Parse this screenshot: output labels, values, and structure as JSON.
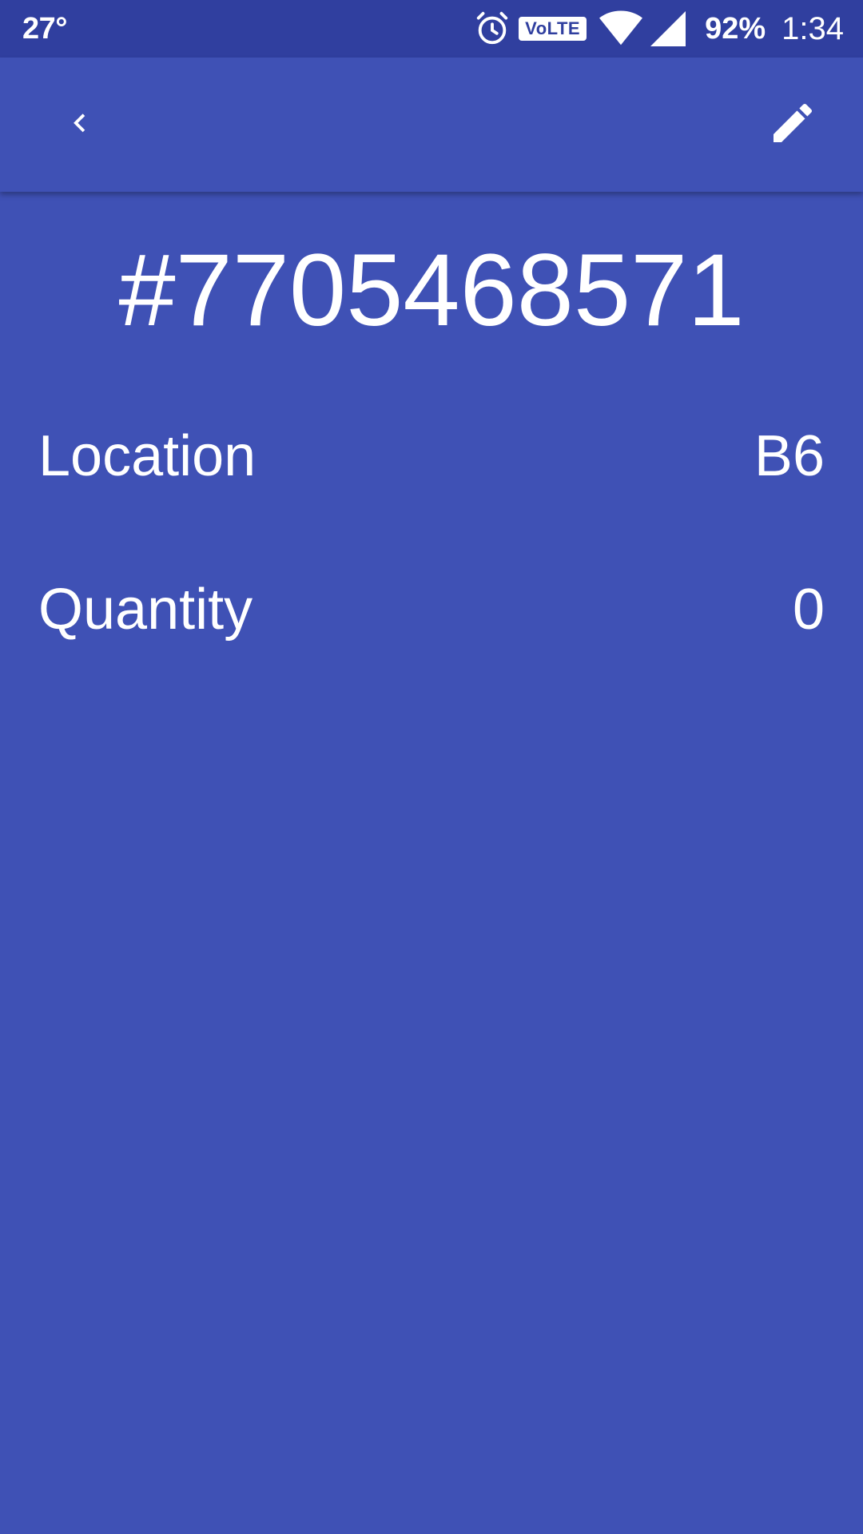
{
  "status_bar": {
    "temperature": "27°",
    "volte_label": "VoLTE",
    "battery": "92%",
    "time": "1:34"
  },
  "app_bar": {
    "back_icon": "chevron-left-icon",
    "edit_icon": "pencil-icon"
  },
  "item": {
    "code": "#7705468571",
    "fields": [
      {
        "label": "Location",
        "value": "B6"
      },
      {
        "label": "Quantity",
        "value": "0"
      }
    ]
  },
  "colors": {
    "primary": "#3f51b5",
    "primary_dark": "#303f9f",
    "on_primary": "#ffffff"
  }
}
